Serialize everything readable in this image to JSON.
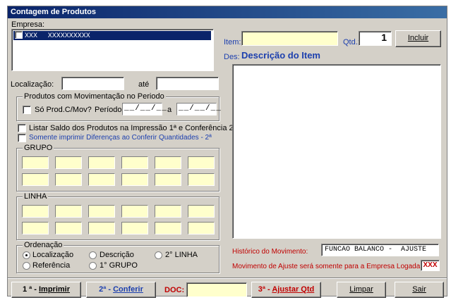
{
  "window": {
    "title": "Contagem de Produtos"
  },
  "empresa": {
    "label": "Empresa:",
    "items": [
      {
        "code": "XXX",
        "name": "XXXXXXXXXX"
      }
    ]
  },
  "localizacao": {
    "label": "Localização:",
    "ate_label": "até",
    "from_value": "",
    "to_value": ""
  },
  "movimentacao": {
    "title": "Produtos com Movimentação no Periodo",
    "checkbox_label": "Só Prod.C/Mov?",
    "periodo_label": "Período:",
    "date_from": "__/__/__",
    "a_label": "a",
    "date_to": "__/__/__"
  },
  "options": {
    "listar_saldo": "Listar Saldo dos Produtos na Impressão 1ª e Conferência 2ª",
    "somente_diferencas": "Somente imprimir Diferenças ao Conferir Quantidades - 2ª"
  },
  "grupo": {
    "title": "GRUPO"
  },
  "linha": {
    "title": "LINHA"
  },
  "ordenacao": {
    "title": "Ordenação",
    "options": [
      "Localização",
      "Descrição",
      "2° LINHA",
      "Referência",
      "1° GRUPO"
    ],
    "selected": "Localização"
  },
  "item": {
    "label": "Item:",
    "value": "",
    "qtd_label": "Qtd.:",
    "qtd_value": "1",
    "incluir_label": "Incluir",
    "des_label": "Des:",
    "descricao": "Descrição do Item"
  },
  "historico": {
    "label": "Histórico do Movimento:",
    "value": "FUNCAO BALANCO -  AJUSTE"
  },
  "ajuste_notice": {
    "text": "Movimento de Ajuste será somente para a Empresa Logada :",
    "badge": "XXX"
  },
  "footer": {
    "imprimir_num": "1 ª - ",
    "imprimir": "Imprimir",
    "conferir_num": "2ª - ",
    "conferir": "Conferir",
    "doc_label": "DOC:",
    "doc_value": "",
    "ajustar_num": "3ª - ",
    "ajustar": "Ajustar Qtd",
    "limpar": "Limpar",
    "sair": "Sair"
  }
}
